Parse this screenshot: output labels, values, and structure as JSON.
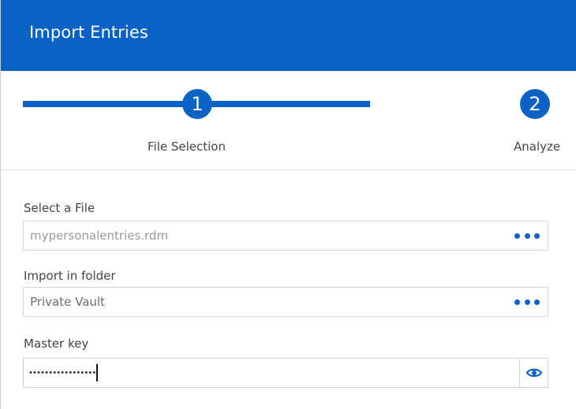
{
  "window": {
    "title": "Import Entries"
  },
  "stepper": {
    "steps": [
      {
        "number": "1",
        "label": "File Selection",
        "active": true
      },
      {
        "number": "2",
        "label": "Analyze",
        "active": false
      }
    ]
  },
  "form": {
    "file": {
      "label": "Select a File",
      "placeholder": "mypersonalentries.rdm",
      "value": ""
    },
    "folder": {
      "label": "Import in folder",
      "value": "Private Vault"
    },
    "master_key": {
      "label": "Master key",
      "masked_value": "•••••••••••••••••"
    }
  },
  "icons": {
    "browse": "more-dots-icon",
    "reveal": "eye-icon"
  },
  "colors": {
    "accent": "#0a63c4"
  }
}
